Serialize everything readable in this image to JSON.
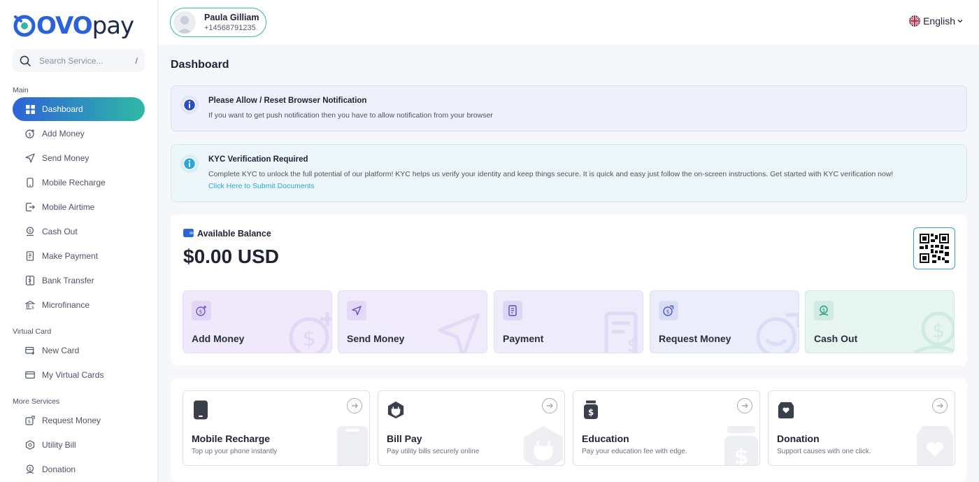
{
  "brand": {
    "logo_main": "OVO",
    "logo_pay": "pay",
    "primary": "#2d64d8",
    "accent": "#2fb8a5"
  },
  "search": {
    "placeholder": "Search Service...",
    "shortcut": "/"
  },
  "sidebar": {
    "sections": [
      {
        "title": "Main",
        "items": [
          {
            "label": "Dashboard",
            "icon": "grid-icon",
            "active": true
          },
          {
            "label": "Add Money",
            "icon": "coin-plus-icon"
          },
          {
            "label": "Send Money",
            "icon": "send-icon"
          },
          {
            "label": "Mobile Recharge",
            "icon": "phone-icon"
          },
          {
            "label": "Mobile Airtime",
            "icon": "airtime-icon"
          },
          {
            "label": "Cash Out",
            "icon": "cash-out-icon"
          },
          {
            "label": "Make Payment",
            "icon": "receipt-icon"
          },
          {
            "label": "Bank Transfer",
            "icon": "bank-transfer-icon"
          },
          {
            "label": "Microfinance",
            "icon": "microfinance-icon"
          }
        ]
      },
      {
        "title": "Virtual Card",
        "items": [
          {
            "label": "New Card",
            "icon": "card-plus-icon"
          },
          {
            "label": "My Virtual Cards",
            "icon": "card-icon"
          }
        ]
      },
      {
        "title": "More Services",
        "items": [
          {
            "label": "Request Money",
            "icon": "request-money-icon"
          },
          {
            "label": "Utility Bill",
            "icon": "utility-icon"
          },
          {
            "label": "Donation",
            "icon": "donation-icon"
          }
        ]
      }
    ]
  },
  "user": {
    "name": "Paula Gilliam",
    "phone": "+14568791235"
  },
  "language": {
    "selected": "English"
  },
  "page": {
    "title": "Dashboard"
  },
  "alerts": {
    "notification": {
      "title": "Please Allow / Reset Browser Notification",
      "text": "If you want to get push notification then you have to allow notification from your browser"
    },
    "kyc": {
      "title": "KYC Verification Required",
      "text": "Complete KYC to unlock the full potential of our platform! KYC helps us verify your identity and keep things secure. It is quick and easy just follow the on-screen instructions. Get started with KYC verification now!",
      "link": "Click Here to Submit Documents"
    }
  },
  "balance": {
    "label": "Available Balance",
    "value": "$0.00 USD"
  },
  "actions": [
    {
      "label": "Add Money",
      "icon": "coin-plus-icon",
      "bg": "#efe9fb",
      "icon_bg": "#e2d6f8",
      "color": "#7b4fd6"
    },
    {
      "label": "Send Money",
      "icon": "send-icon",
      "bg": "#f0ebfb",
      "icon_bg": "#e3d8f8",
      "color": "#6c49c9"
    },
    {
      "label": "Payment",
      "icon": "receipt-icon",
      "bg": "#eeebfa",
      "icon_bg": "#ddd7f6",
      "color": "#5a48c2"
    },
    {
      "label": "Request Money",
      "icon": "request-money-icon",
      "bg": "#ebedfb",
      "icon_bg": "#d8dcf7",
      "color": "#4a56c8"
    },
    {
      "label": "Cash Out",
      "icon": "cash-out-icon",
      "bg": "#e7f5f1",
      "icon_bg": "#cfeae2",
      "color": "#2b9a7c"
    }
  ],
  "services": [
    {
      "title": "Mobile Recharge",
      "desc": "Top up your phone instantly",
      "icon": "phone-icon"
    },
    {
      "title": "Bill Pay",
      "desc": "Pay utility bills securely online",
      "icon": "plug-icon"
    },
    {
      "title": "Education",
      "desc": "Pay your education fee with edge.",
      "icon": "jar-icon"
    },
    {
      "title": "Donation",
      "desc": "Support causes with one click.",
      "icon": "heart-box-icon"
    }
  ]
}
